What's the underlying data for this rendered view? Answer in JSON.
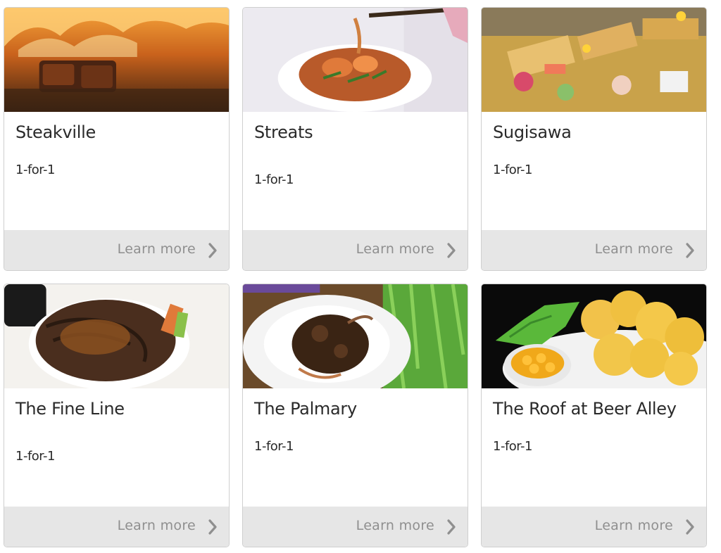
{
  "cards": [
    {
      "name": "Steakville",
      "offer": "1-for-1",
      "cta": "Learn more",
      "image": "flaming-steak-photo"
    },
    {
      "name": "Streats",
      "offer": "1-for-1",
      "cta": "Learn more",
      "image": "noodle-dish-photo"
    },
    {
      "name": "Sugisawa",
      "offer": "1-for-1",
      "cta": "Learn more",
      "image": "sashimi-platter-photo"
    },
    {
      "name": "The Fine Line",
      "offer": "1-for-1",
      "cta": "Learn more",
      "image": "ribeye-steak-photo"
    },
    {
      "name": "The Palmary",
      "offer": "1-for-1",
      "cta": "Learn more",
      "image": "chili-crab-photo"
    },
    {
      "name": "The Roof at Beer Alley",
      "offer": "1-for-1",
      "cta": "Learn more",
      "image": "nachos-plate-photo"
    }
  ],
  "colors": {
    "card_border": "#cfcfcf",
    "footer_bg": "#e6e6e6",
    "footer_text": "#8f8f8f",
    "title_text": "#2a2a2a"
  }
}
